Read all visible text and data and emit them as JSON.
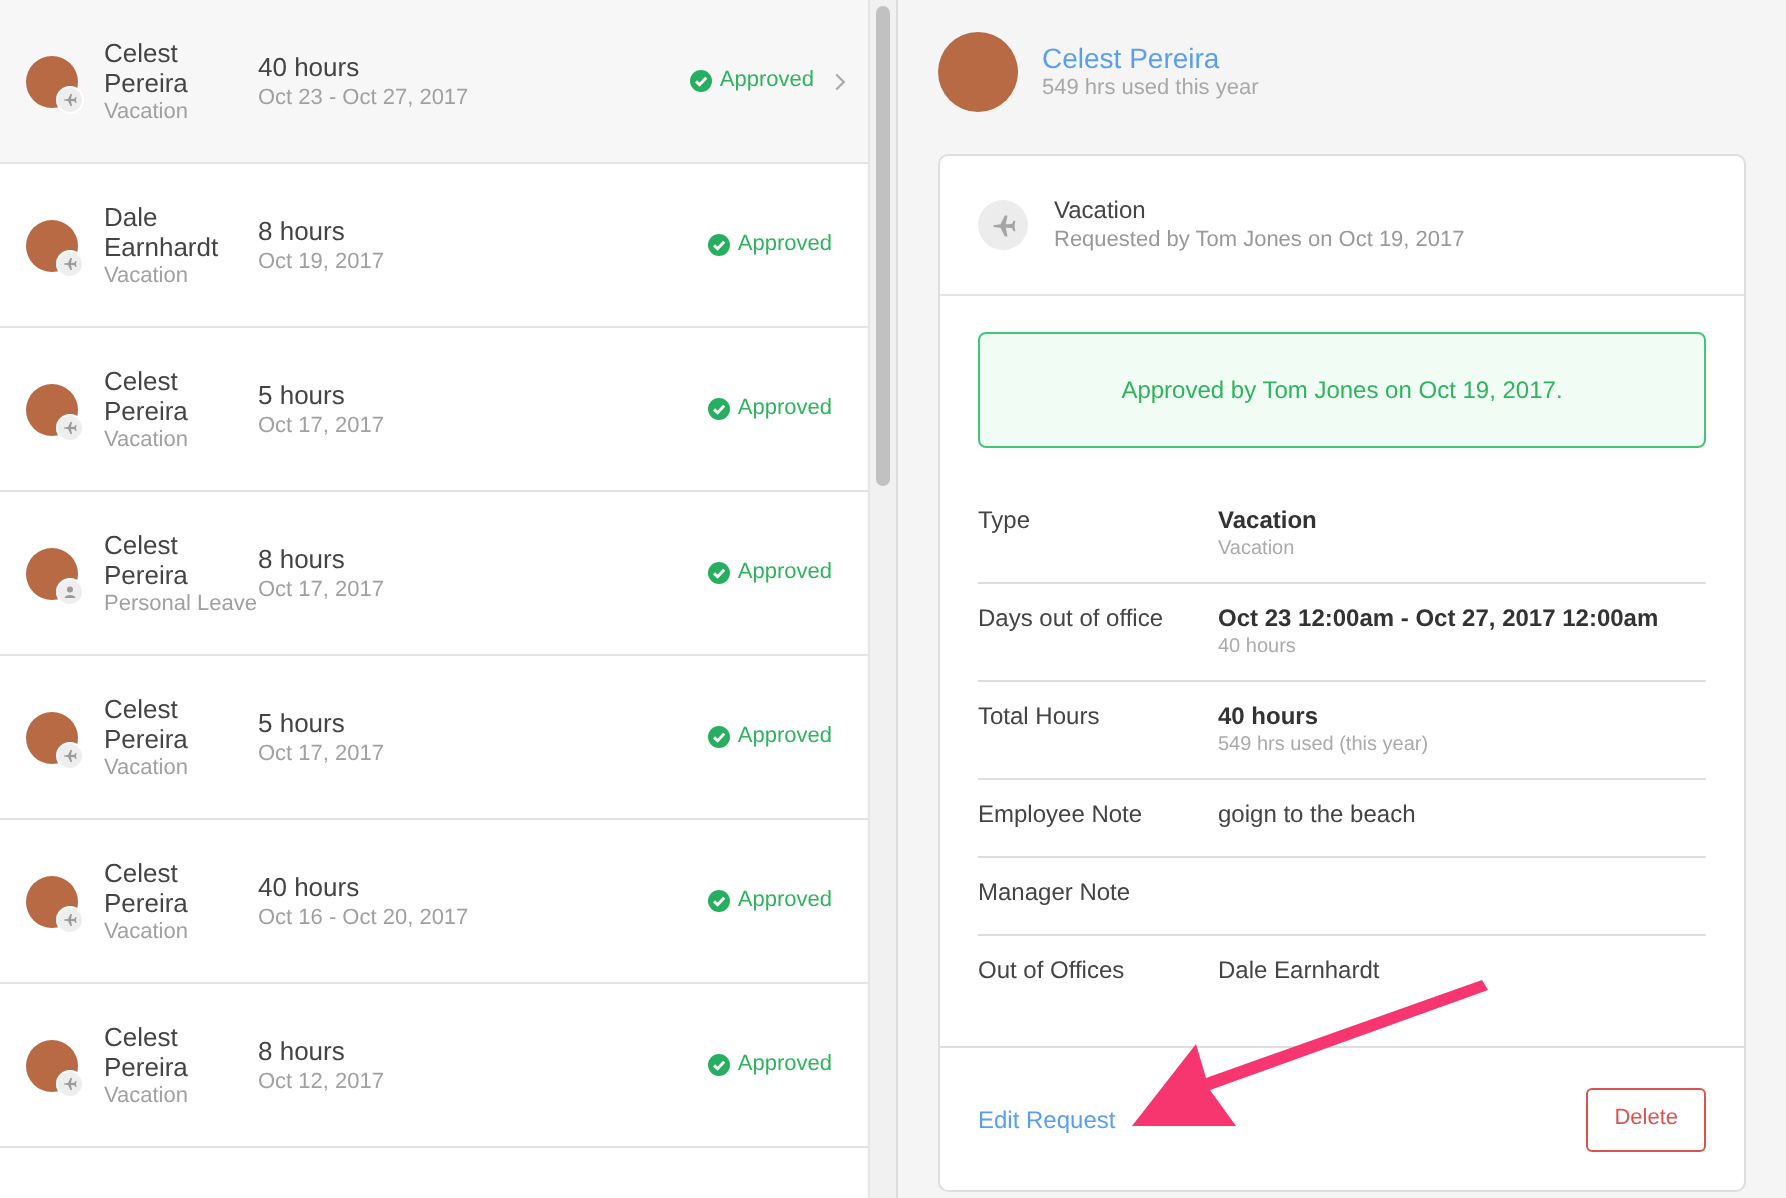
{
  "requests": [
    {
      "name": "Celest Pereira",
      "leave_type": "Vacation",
      "kind": "vacation",
      "hours": "40 hours",
      "dates": "Oct 23 - Oct 27, 2017",
      "status": "Approved",
      "selected": true
    },
    {
      "name": "Dale Earnhardt",
      "leave_type": "Vacation",
      "kind": "vacation",
      "hours": "8 hours",
      "dates": "Oct 19, 2017",
      "status": "Approved",
      "selected": false
    },
    {
      "name": "Celest Pereira",
      "leave_type": "Vacation",
      "kind": "vacation",
      "hours": "5 hours",
      "dates": "Oct 17, 2017",
      "status": "Approved",
      "selected": false
    },
    {
      "name": "Celest Pereira",
      "leave_type": "Personal Leave",
      "kind": "personal",
      "hours": "8 hours",
      "dates": "Oct 17, 2017",
      "status": "Approved",
      "selected": false
    },
    {
      "name": "Celest Pereira",
      "leave_type": "Vacation",
      "kind": "vacation",
      "hours": "5 hours",
      "dates": "Oct 17, 2017",
      "status": "Approved",
      "selected": false
    },
    {
      "name": "Celest Pereira",
      "leave_type": "Vacation",
      "kind": "vacation",
      "hours": "40 hours",
      "dates": "Oct 16 - Oct 20, 2017",
      "status": "Approved",
      "selected": false
    },
    {
      "name": "Celest Pereira",
      "leave_type": "Vacation",
      "kind": "vacation",
      "hours": "8 hours",
      "dates": "Oct 12, 2017",
      "status": "Approved",
      "selected": false
    }
  ],
  "detail": {
    "employee": {
      "name": "Celest Pereira",
      "usage": "549 hrs used this year"
    },
    "request": {
      "title": "Vacation",
      "subtitle": "Requested by Tom Jones on Oct 19, 2017",
      "kind": "vacation"
    },
    "banner": "Approved by Tom Jones on Oct 19, 2017.",
    "fields": [
      {
        "label": "Type",
        "value": "Vacation",
        "note": "Vacation"
      },
      {
        "label": "Days out of office",
        "value": "Oct 23 12:00am - Oct 27, 2017 12:00am",
        "note": "40 hours"
      },
      {
        "label": "Total Hours",
        "value": "40 hours",
        "note": "549 hrs used (this year)"
      },
      {
        "label": "Employee Note",
        "value": "goign to the beach"
      },
      {
        "label": "Manager Note"
      },
      {
        "label": "Out of Offices",
        "value": "Dale Earnhardt"
      }
    ],
    "edit_link": "Edit Request",
    "delete_button": "Delete"
  }
}
